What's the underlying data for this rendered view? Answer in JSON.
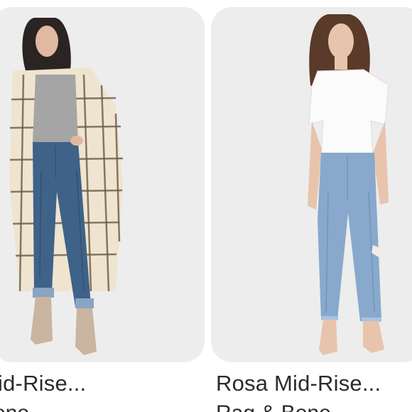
{
  "products": [
    {
      "title": "Mid-Rise...",
      "brand": "Bone"
    },
    {
      "title": "Rosa Mid-Rise...",
      "brand": "Rag & Bone"
    }
  ],
  "icons": {
    "left_image": "model-in-plaid-coat-and-jeans-photo",
    "right_image": "model-in-white-tee-and-light-jeans-photo"
  }
}
